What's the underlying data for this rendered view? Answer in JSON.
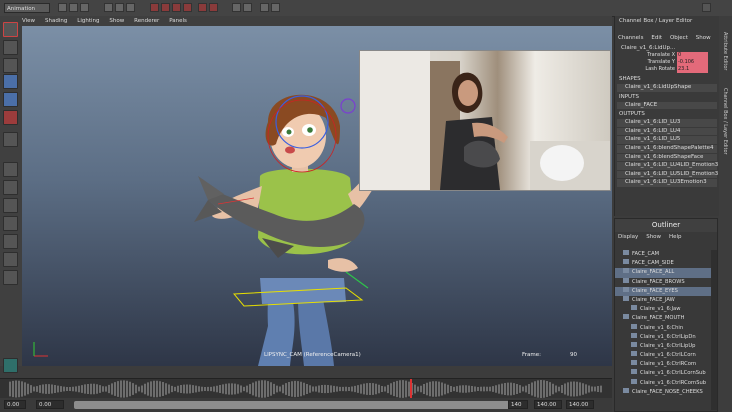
{
  "toolbar": {
    "mode_menu": "Animation"
  },
  "viewport": {
    "menu": [
      "View",
      "Shading",
      "Lighting",
      "Show",
      "Renderer",
      "Panels"
    ],
    "camera_label": "LIPSYNC_CAM (ReferenceCamera1)",
    "frame_label": "Frame:",
    "frame_value": "90"
  },
  "channel_box": {
    "title": "Channel Box / Layer Editor",
    "menu": [
      "Channels",
      "Edit",
      "Object",
      "Show"
    ],
    "object_name": "Claire_v1_6:LidUp...",
    "attributes": [
      {
        "name": "Translate X",
        "value": "0"
      },
      {
        "name": "Translate Y",
        "value": "-0.106"
      },
      {
        "name": "Lash Rotate",
        "value": "23.1"
      }
    ],
    "shapes_header": "SHAPES",
    "shape": "Claire_v1_6:LidUpShape",
    "inputs_header": "INPUTS",
    "input": "Claire_FACE",
    "outputs_header": "OUTPUTS",
    "outputs": [
      "Claire_v1_6:LID_LU3",
      "Claire_v1_6:LID_LU4",
      "Claire_v1_6:LID_LU5",
      "Claire_v1_6:blendShapePalette4",
      "Claire_v1_6:blendShapeFace",
      "Claire_v1_6:LID_LU4LID_Emotion3",
      "Claire_v1_6:LID_LU5LID_Emotion3",
      "Claire_v1_6:LID_LU3Emotion3"
    ]
  },
  "side_tabs": [
    "Attribute Editor",
    "Channel Box / Layer Editor"
  ],
  "outliner": {
    "title": "Outliner",
    "menu": [
      "Display",
      "Show",
      "Help"
    ],
    "items": [
      {
        "label": "FACE_CAM",
        "selected": false
      },
      {
        "label": "FACE_CAM_SIDE",
        "selected": false
      },
      {
        "label": "Claire_FACE_ALL",
        "selected": true
      },
      {
        "label": "Claire_FACE_BROWS",
        "selected": false
      },
      {
        "label": "Claire_FACE_EYES",
        "selected": true
      },
      {
        "label": "Claire_FACE_JAW",
        "selected": false
      },
      {
        "label": "Claire_v1_6:Jaw",
        "selected": false
      },
      {
        "label": "Claire_FACE_MOUTH",
        "selected": false
      },
      {
        "label": "Claire_v1_6:Chin",
        "selected": false
      },
      {
        "label": "Claire_v1_6:CtrlLipDn",
        "selected": false
      },
      {
        "label": "Claire_v1_6:CtrlLipUp",
        "selected": false
      },
      {
        "label": "Claire_v1_6:CtrlLCorn",
        "selected": false
      },
      {
        "label": "Claire_v1_6:CtrlRCorn",
        "selected": false
      },
      {
        "label": "Claire_v1_6:CtrlLCornSub",
        "selected": false
      },
      {
        "label": "Claire_v1_6:CtrlRCornSub",
        "selected": false
      },
      {
        "label": "Claire_FACE_NOSE_CHEEKS",
        "selected": false
      }
    ]
  },
  "range": {
    "start": "0.00",
    "inner_start": "0.00",
    "inner_end": "140",
    "outer_end": "140.00",
    "end": "140.00"
  },
  "colors": {
    "selection": "#5f6f86",
    "attribute_highlight": "#e36a7a",
    "bbox": "#e8e000"
  }
}
